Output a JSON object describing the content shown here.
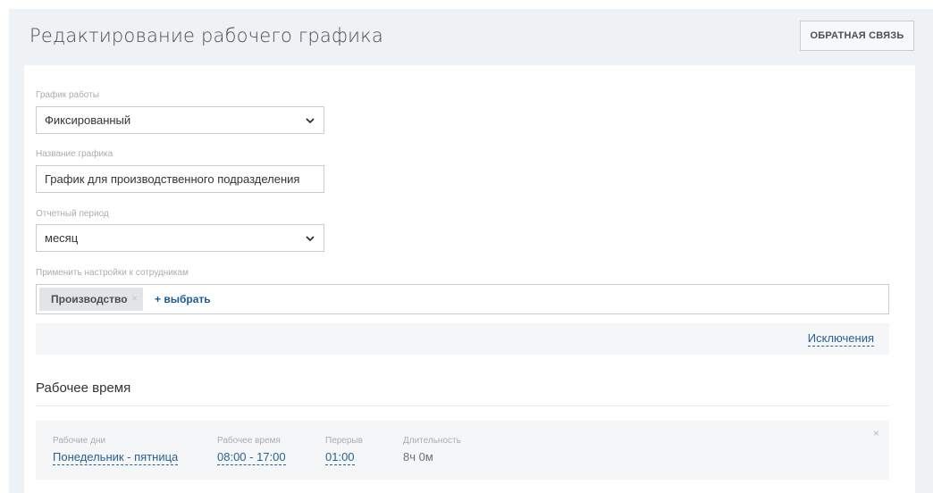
{
  "header": {
    "title": "Редактирование рабочего графика",
    "feedback_label": "ОБРАТНАЯ СВЯЗЬ"
  },
  "form": {
    "schedule_type": {
      "label": "График работы",
      "value": "Фиксированный",
      "icon": "chevron-down-icon"
    },
    "schedule_name": {
      "label": "Название графика",
      "value": "График для производственного подразделения"
    },
    "report_period": {
      "label": "Отчетный период",
      "value": "месяц",
      "icon": "chevron-down-icon"
    },
    "employees": {
      "label": "Применить настройки к сотрудникам",
      "tags": [
        {
          "label": "Производство",
          "close_icon": "×"
        }
      ],
      "add_label": "+ выбрать"
    },
    "exceptions_label": "Исключения"
  },
  "work_time": {
    "heading": "Рабочее время",
    "rows": [
      {
        "days_label": "Рабочие дни",
        "days_value": "Понедельник - пятница",
        "time_label": "Рабочее время",
        "time_value": "08:00 - 17:00",
        "break_label": "Перерыв",
        "break_value": "01:00",
        "duration_label": "Длительность",
        "duration_value": "8ч 0м",
        "close_icon": "×"
      }
    ]
  },
  "colors": {
    "page_bg": "#eef2f4",
    "card_bg": "#ffffff",
    "link": "#2a5f93",
    "accent_link": "#1a5a9a",
    "border": "#c9cdd1",
    "muted_text": "#a8adb2"
  }
}
